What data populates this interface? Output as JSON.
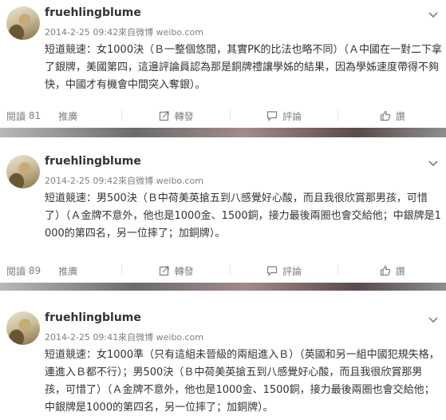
{
  "posts": [
    {
      "username": "fruehlingblume",
      "timestamp": "2014-2-25 09:42",
      "source": "來自微博 weibo.com",
      "text": "短道競速：女1000決（Ｂ一整個悠閒，其實PK的比法也略不同）（Ａ中國在一對二下拿了銀牌，美國第四，這邊評論員認為那是銅牌禮讓學姊的結果，因為學姊速度帶得不夠快，中國才有機會中間突入奪銀）。",
      "read_label": "閱讀",
      "read_count": "81",
      "promote_label": "推廣",
      "repost_label": "轉發",
      "comment_label": "評論",
      "like_label": "讚"
    },
    {
      "username": "fruehlingblume",
      "timestamp": "2014-2-25 09:42",
      "source": "來自微博 weibo.com",
      "text": "短道競速：男500決（Ｂ中荷美英搶五到八感覺好心酸，而且我很欣賞那男孩，可惜了）（Ａ金牌不意外，他也是1000金、1500銅，接力最後兩圈也會交給他；中銀牌是1000的第四名，另一位摔了；加銅牌）。",
      "read_label": "閱讀",
      "read_count": "89",
      "promote_label": "推廣",
      "repost_label": "轉發",
      "comment_label": "評論",
      "like_label": "讚"
    },
    {
      "username": "fruehlingblume",
      "timestamp": "2014-2-25 09:41",
      "source": "來自微博 weibo.com",
      "text": "短道競速：女1000準（只有這組未晉級的兩組進入Ｂ）（英國和另一組中國犯規失格，連進入Ｂ都不行）；男500決（Ｂ中荷美英搶五到八感覺好心酸，而且我很欣賞那男孩，可惜了）（Ａ金牌不意外，他也是1000金、1500銅，接力最後兩圈也會交給他；中銀牌是1000的第四名，另一位摔了；加銅牌）。"
    }
  ],
  "colors": {
    "text": "#333333",
    "meta": "#808080",
    "separator": "#e6e6e6"
  },
  "icons": [
    "chevron-down-icon",
    "repost-icon",
    "comment-icon",
    "like-icon"
  ]
}
